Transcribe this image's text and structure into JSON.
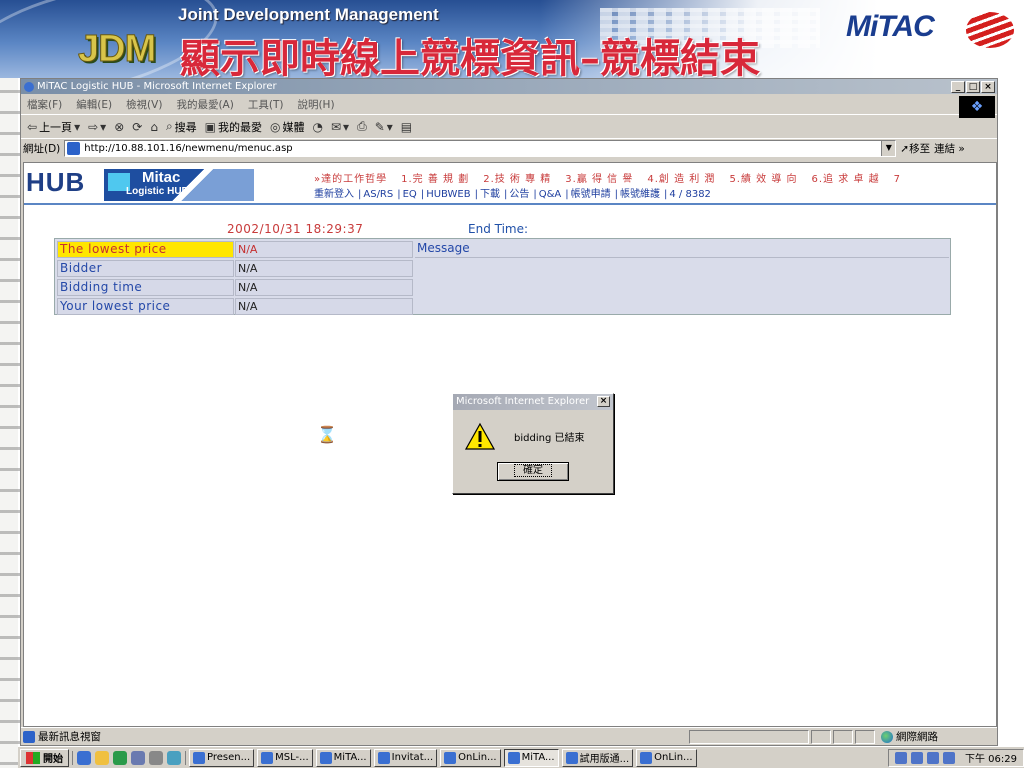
{
  "slide": {
    "banner_title": "Joint Development Management",
    "jdm_logo": "JDM",
    "heading": "顯示即時線上競標資訊–競標結束",
    "mitac_logo": "MiTAC"
  },
  "browser": {
    "title": "MiTAC Logistic HUB - Microsoft Internet Explorer",
    "window_buttons": [
      "_",
      "□",
      "×"
    ],
    "menu": [
      "檔案(F)",
      "編輯(E)",
      "檢視(V)",
      "我的最愛(A)",
      "工具(T)",
      "說明(H)"
    ],
    "toolbar": {
      "back": "上一頁",
      "search": "搜尋",
      "favorites": "我的最愛",
      "media": "媒體"
    },
    "address": {
      "label": "網址(D)",
      "url": "http://10.88.101.16/newmenu/menuc.asp",
      "go": "移至",
      "links": "連結"
    },
    "status": {
      "text": "最新訊息視窗",
      "zone": "網際網路"
    }
  },
  "page": {
    "hub_logo": "HUB",
    "mitac_badge_name": "Mitac",
    "mitac_badge_sub": "Logistic HUB",
    "nav_top": [
      "»達的工作哲學",
      "1.完 善 規 劃",
      "2.技 術 專 精",
      "3.贏 得 信 譽",
      "4.創 造 利 潤",
      "5.績 效 導 向",
      "6.追 求 卓 越",
      "7"
    ],
    "nav_links": [
      "重新登入",
      "AS/RS",
      "EQ",
      "HUBWEB",
      "下載",
      "公告",
      "Q&A",
      "帳號申請",
      "帳號維護",
      "4 / 8382"
    ],
    "bid_datetime": "2002/10/31 18:29:37",
    "endtime_label": "End Time:",
    "bid_rows": [
      {
        "label": "The lowest price",
        "value": "N/A",
        "highlight": true
      },
      {
        "label": "Bidder",
        "value": "N/A",
        "highlight": false
      },
      {
        "label": "Bidding time",
        "value": "N/A",
        "highlight": false
      },
      {
        "label": "Your lowest price",
        "value": "N/A",
        "highlight": false
      }
    ],
    "message_label": "Message"
  },
  "dialog": {
    "title": "Microsoft Internet Explorer",
    "message": "bidding 已結束",
    "ok": "確定"
  },
  "taskbar": {
    "start": "開始",
    "tasks": [
      {
        "label": "Presen...",
        "active": false
      },
      {
        "label": "MSL-...",
        "active": false
      },
      {
        "label": "MiTA...",
        "active": false
      },
      {
        "label": "Invitat...",
        "active": false
      },
      {
        "label": "OnLin...",
        "active": false
      },
      {
        "label": "MiTA...",
        "active": true
      },
      {
        "label": "試用版通...",
        "active": false
      },
      {
        "label": "OnLin...",
        "active": false
      }
    ],
    "clock": "下午 06:29"
  },
  "colors": {
    "heading_red": "#d8283a",
    "hub_blue": "#1f3f86",
    "highlight_yellow": "#ffe600",
    "table_bg": "#d6d9e8"
  }
}
